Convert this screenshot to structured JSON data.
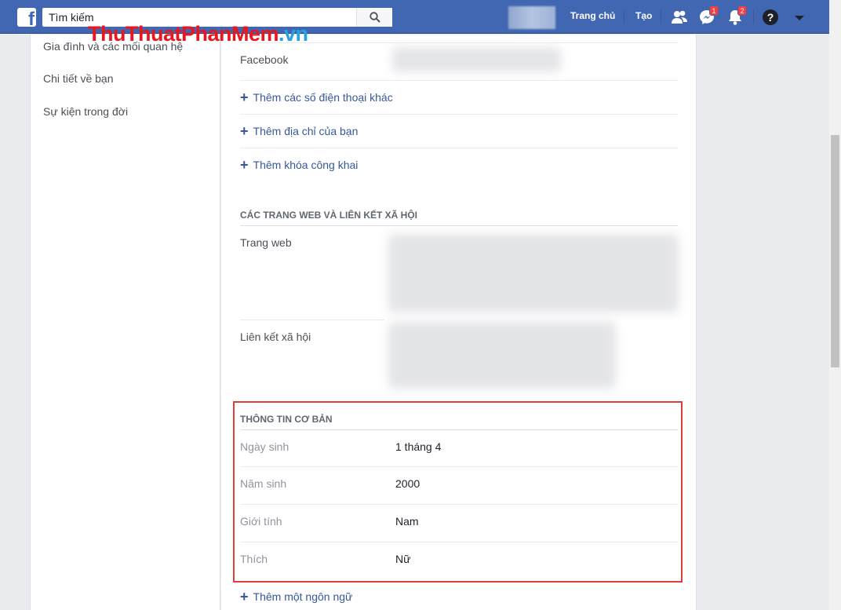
{
  "topbar": {
    "logo": "f",
    "search_placeholder": "Tìm kiếm",
    "home_label": "Trang chủ",
    "create_label": "Tạo",
    "messenger_badge": "1",
    "notifications_badge": "2"
  },
  "watermark": {
    "part1": "ThuThuat",
    "part2": "PhanMem",
    "part3": ".vn"
  },
  "sidebar": {
    "items": [
      {
        "label": "Gia đình và các mối quan hệ"
      },
      {
        "label": "Chi tiết về bạn"
      },
      {
        "label": "Sự kiện trong đời"
      }
    ]
  },
  "contact": {
    "facebook_label": "Facebook",
    "add_phone": "Thêm các số điện thoại khác",
    "add_address": "Thêm địa chỉ của bạn",
    "add_public_key": "Thêm khóa công khai"
  },
  "websites": {
    "title": "CÁC TRANG WEB VÀ LIÊN KẾT XÃ HỘI",
    "website_label": "Trang web",
    "social_label": "Liên kết xã hội"
  },
  "basic_info": {
    "title": "THÔNG TIN CƠ BẢN",
    "rows": [
      {
        "label": "Ngày sinh",
        "value": "1 tháng 4"
      },
      {
        "label": "Năm sinh",
        "value": "2000"
      },
      {
        "label": "Giới tính",
        "value": "Nam"
      },
      {
        "label": "Thích",
        "value": "Nữ"
      }
    ]
  },
  "add_language": "Thêm một ngôn ngữ",
  "colors": {
    "brand": "#4267b2",
    "link": "#365899",
    "highlight": "#e03c3c",
    "badge": "#fa3e3e"
  }
}
